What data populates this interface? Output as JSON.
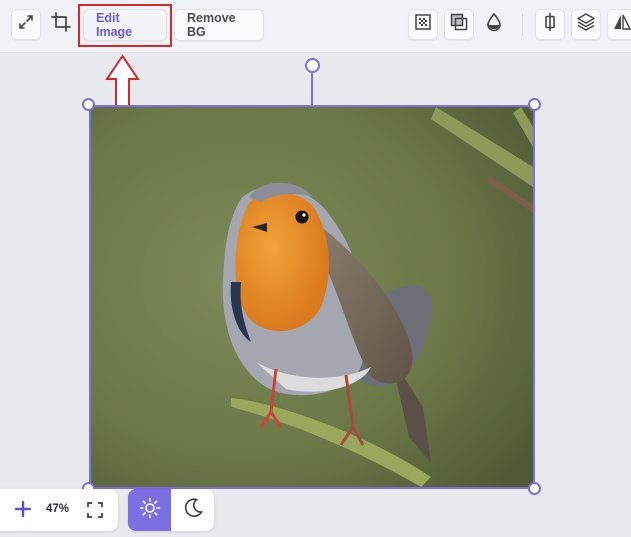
{
  "toolbar": {
    "edit_image_label": "Edit Image",
    "remove_bg_label": "Remove BG",
    "icons": [
      "expand-icon",
      "crop-icon",
      "transparency-icon",
      "overlap-icon",
      "drop-icon",
      "align-icon",
      "layers-icon",
      "flip-icon"
    ]
  },
  "zoom": {
    "value": "47%"
  },
  "theme": {
    "active": "light"
  },
  "colors": {
    "accent": "#7b6fe2",
    "highlight": "#d9262e",
    "toolbar_bg": "#f1f2f5",
    "canvas_bg": "#e9eaee"
  },
  "canvas": {
    "image_subject": "robin on branch"
  }
}
